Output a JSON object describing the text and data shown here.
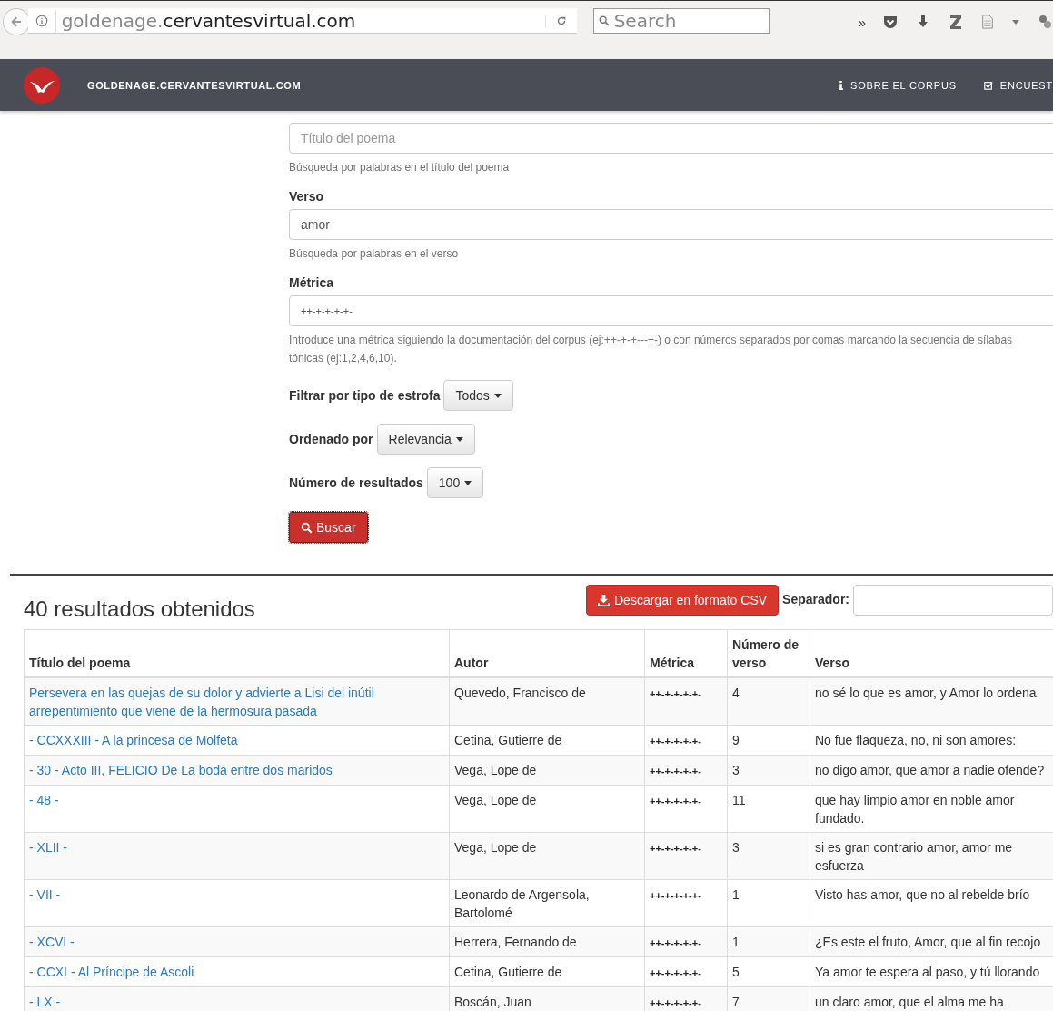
{
  "browser": {
    "url_subdomain": "goldenage.",
    "url_domain": "cervantesvirtual.com",
    "search_placeholder": "Search",
    "overflow": "»"
  },
  "navbar": {
    "brand": "GOLDENAGE.CERVANTESVIRTUAL.COM",
    "links": [
      {
        "label": "SOBRE EL CORPUS",
        "kind": "info"
      },
      {
        "label": "ENCUEST",
        "kind": "check"
      }
    ]
  },
  "form": {
    "title_field": {
      "placeholder": "Título del poema",
      "help": "Búsqueda por palabras en el título del poema"
    },
    "text_fields": [
      {
        "label": "Verso",
        "value": "amor",
        "help": "Búsqueda por palabras en el verso"
      },
      {
        "label": "Métrica",
        "value": "++-+-+-+-+-",
        "help": "Introduce una métrica siguiendo la documentación del corpus (ej:++-+-+---+-) o con números separados por comas marcando la secuencia de sílabas tónicas (ej:1,2,4,6,10)."
      }
    ],
    "dropdowns": [
      {
        "label": "Filtrar por tipo de estrofa",
        "value": "Todos"
      },
      {
        "label": "Ordenado por",
        "value": "Relevancia"
      },
      {
        "label": "Número de resultados",
        "value": "100"
      }
    ],
    "search_button": "Buscar"
  },
  "results": {
    "heading": "40 resultados obtenidos",
    "csv_button": "Descargar en formato CSV",
    "separator_label": "Separador:",
    "table": {
      "columns": [
        "Título del poema",
        "Autor",
        "Métrica",
        "Número de verso",
        "Verso"
      ],
      "rows": [
        {
          "title": "Persevera en las quejas de su dolor y advierte a Lisi del inútil arrepentimiento que viene de la hermosura pasada",
          "author": "Quevedo, Francisco de",
          "metric": "++-+-+-+-+-",
          "number": "4",
          "verse": "no sé lo que es amor, y Amor lo ordena."
        },
        {
          "title": "- CCXXXIII - A la princesa de Molfeta",
          "author": "Cetina, Gutierre de",
          "metric": "++-+-+-+-+-",
          "number": "9",
          "verse": "No fue flaqueza, no, ni son amores:"
        },
        {
          "title": "- 30 - Acto III, FELICIO De La boda entre dos maridos",
          "author": "Vega, Lope de",
          "metric": "++-+-+-+-+-",
          "number": "3",
          "verse": "no digo amor, que amor a nadie ofende?"
        },
        {
          "title": "- 48 -",
          "author": "Vega, Lope de",
          "metric": "++-+-+-+-+-",
          "number": "11",
          "verse": "que hay limpio amor en noble amor fundado."
        },
        {
          "title": "- XLII -",
          "author": "Vega, Lope de",
          "metric": "++-+-+-+-+-",
          "number": "3",
          "verse": "si es gran contrario amor, amor me esfuerza"
        },
        {
          "title": "- VII -",
          "author": "Leonardo de Argensola, Bartolomé",
          "metric": "++-+-+-+-+-",
          "number": "1",
          "verse": "Visto has amor, que no al rebelde brío"
        },
        {
          "title": "- XCVI -",
          "author": "Herrera, Fernando de",
          "metric": "++-+-+-+-+-",
          "number": "1",
          "verse": "¿Es este el fruto, Amor, que al fin recojo"
        },
        {
          "title": "- CCXI - Al Príncipe de Ascoli",
          "author": "Cetina, Gutierre de",
          "metric": "++-+-+-+-+-",
          "number": "5",
          "verse": "Ya amor te espera al paso, y tú llorando"
        },
        {
          "title": "- LX -",
          "author": "Boscán, Juan",
          "metric": "++-+-+-+-+-",
          "number": "7",
          "verse": "un claro amor, que el alma me ha"
        }
      ]
    }
  }
}
